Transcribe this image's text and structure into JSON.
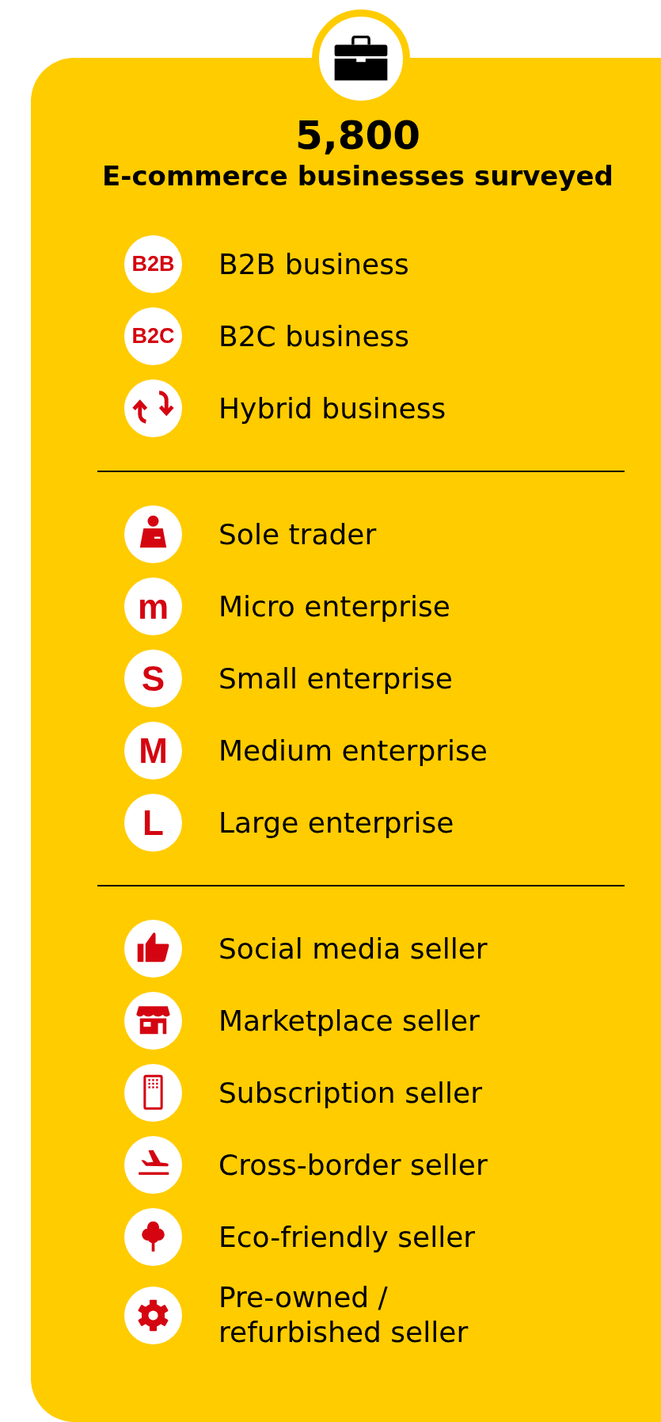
{
  "header": {
    "count": "5,800",
    "caption": "E-commerce businesses surveyed"
  },
  "groups": [
    {
      "items": [
        {
          "label": "B2B business",
          "icon": {
            "kind": "letters",
            "text": "B2B"
          }
        },
        {
          "label": "B2C business",
          "icon": {
            "kind": "letters",
            "text": "B2C"
          }
        },
        {
          "label": "Hybrid business",
          "icon": {
            "kind": "arrows"
          }
        }
      ]
    },
    {
      "items": [
        {
          "label": "Sole trader",
          "icon": {
            "kind": "person"
          }
        },
        {
          "label": "Micro enterprise",
          "icon": {
            "kind": "letter",
            "text": "m"
          }
        },
        {
          "label": "Small enterprise",
          "icon": {
            "kind": "letter",
            "text": "S"
          }
        },
        {
          "label": "Medium enterprise",
          "icon": {
            "kind": "letter",
            "text": "M"
          }
        },
        {
          "label": "Large enterprise",
          "icon": {
            "kind": "letter",
            "text": "L"
          }
        }
      ]
    },
    {
      "items": [
        {
          "label": "Social media seller",
          "icon": {
            "kind": "thumb"
          }
        },
        {
          "label": "Marketplace seller",
          "icon": {
            "kind": "shop"
          }
        },
        {
          "label": "Subscription seller",
          "icon": {
            "kind": "phone"
          }
        },
        {
          "label": "Cross-border seller",
          "icon": {
            "kind": "plane"
          }
        },
        {
          "label": "Eco-friendly seller",
          "icon": {
            "kind": "tree"
          }
        },
        {
          "label": "Pre-owned / refurbished seller",
          "icon": {
            "kind": "gear"
          }
        }
      ]
    }
  ]
}
